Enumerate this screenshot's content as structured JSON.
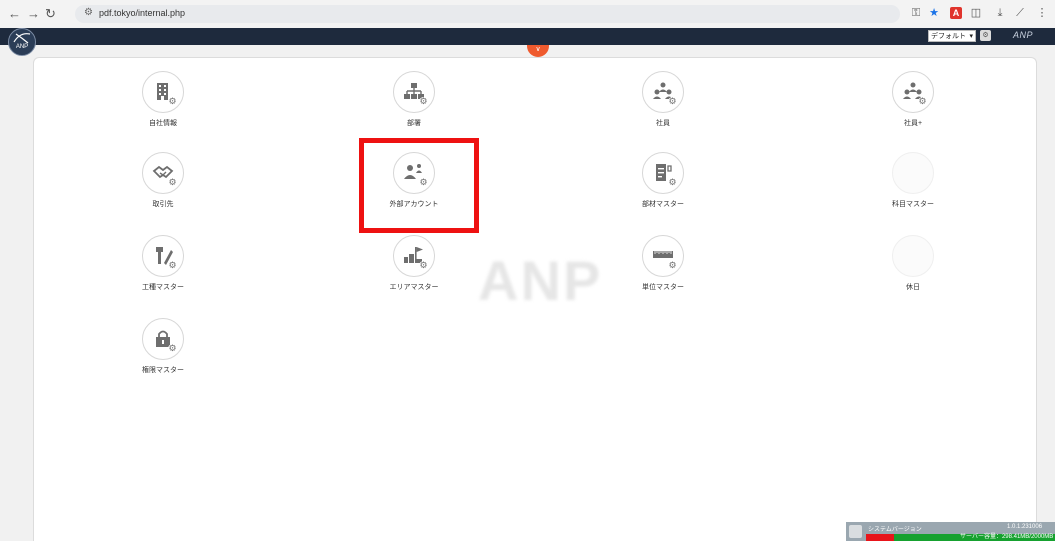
{
  "browser": {
    "url": "pdf.tokyo/internal.php"
  },
  "header": {
    "logo_text": "ANP",
    "select_value": "デフォルト",
    "brand": "ANP"
  },
  "watermark": "ANP",
  "tiles": [
    {
      "label": "自社情報",
      "icon": "building-icon"
    },
    {
      "label": "部署",
      "icon": "org-chart-icon"
    },
    {
      "label": "社員",
      "icon": "employees-icon"
    },
    {
      "label": "社員+",
      "icon": "employees-plus-icon"
    },
    {
      "label": "取引先",
      "icon": "handshake-icon"
    },
    {
      "label": "外部アカウント",
      "icon": "external-account-icon"
    },
    {
      "label": "部材マスター",
      "icon": "materials-icon"
    },
    {
      "label": "科目マスター",
      "icon": "blank-icon"
    },
    {
      "label": "工種マスター",
      "icon": "tools-icon"
    },
    {
      "label": "エリアマスター",
      "icon": "area-icon"
    },
    {
      "label": "単位マスター",
      "icon": "ruler-icon"
    },
    {
      "label": "休日",
      "icon": "blank-icon"
    },
    {
      "label": "権限マスター",
      "icon": "lock-icon"
    }
  ],
  "system": {
    "label": "システムバージョン",
    "version": "1.0.1.231006",
    "memory": "サーバー容量：298.41MB/2000MB",
    "memory_used_fraction": 0.149
  },
  "colors": {
    "header_bg": "#1e2a3d",
    "accent_orange": "#ef5a2e",
    "highlight_red": "#ee1111",
    "memory_used": "#e8141a",
    "memory_free": "#16a12f"
  }
}
